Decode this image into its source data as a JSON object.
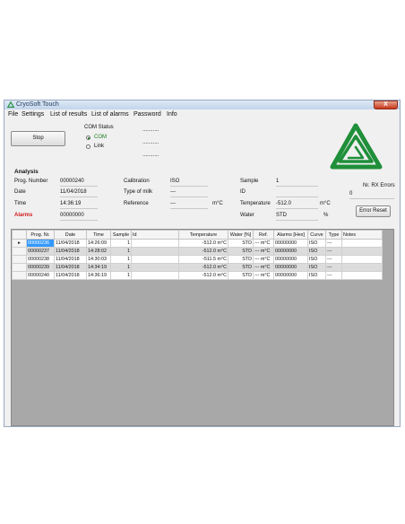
{
  "window": {
    "title": "CryoSoft Touch",
    "close_glyph": "X"
  },
  "menu": [
    "File",
    "Settings",
    "List of results",
    "List of alarms",
    "Password",
    "Info"
  ],
  "controls": {
    "stop_label": "Stop",
    "com_status_label": "COM Status",
    "com_option": "COM",
    "link_option": "Link",
    "status_lines": [
      "...........",
      "...........",
      "..........."
    ]
  },
  "analysis": {
    "heading": "Analysis",
    "prog_number_label": "Prog. Number",
    "prog_number": "00000240",
    "date_label": "Date",
    "date": "11/04/2018",
    "time_label": "Time",
    "time": "14:36:19",
    "alarms_label": "Alarms",
    "alarms": "00000000",
    "calibration_label": "Calibration",
    "calibration": "ISO",
    "milk_label": "Type of milk",
    "milk": "---",
    "reference_label": "Reference",
    "reference": "---",
    "reference_unit": "m°C",
    "sample_label": "Sample",
    "sample": "1",
    "id_label": "ID",
    "id": "",
    "temperature_label": "Temperature",
    "temperature": "-512.0",
    "temperature_unit": "m°C",
    "water_label": "Water",
    "water": "STD",
    "water_unit": "%"
  },
  "rx": {
    "label": "Nr. RX Errors",
    "value": "0",
    "reset_label": "Error Reset"
  },
  "logo": {
    "name": "triangle-logo",
    "color": "#1f8f3a"
  },
  "table": {
    "columns": [
      "Prog. Nr.",
      "Date",
      "Time",
      "Sample",
      "Id",
      "Temperature",
      "Water [%]",
      "Ref.",
      "Alarms [Hex]",
      "Curve",
      "Type",
      "Notes"
    ],
    "rows": [
      [
        "00000236",
        "11/04/2018",
        "14:26:09",
        "1",
        "",
        "-512.0 m°C",
        "STD",
        "--- m°C",
        "00000000",
        "ISO",
        "---",
        ""
      ],
      [
        "00000237",
        "11/04/2018",
        "14:28:02",
        "1",
        "",
        "-512.0 m°C",
        "STD",
        "--- m°C",
        "00000000",
        "ISO",
        "---",
        ""
      ],
      [
        "00000238",
        "11/04/2018",
        "14:30:03",
        "1",
        "",
        "-511.5 m°C",
        "STD",
        "--- m°C",
        "00000000",
        "ISO",
        "---",
        ""
      ],
      [
        "00000239",
        "11/04/2018",
        "14:34:19",
        "1",
        "",
        "-512.0 m°C",
        "STD",
        "--- m°C",
        "00000000",
        "ISO",
        "---",
        ""
      ],
      [
        "00000240",
        "11/04/2018",
        "14:36:19",
        "1",
        "",
        "-512.0 m°C",
        "STD",
        "--- m°C",
        "00000000",
        "ISO",
        "---",
        ""
      ]
    ],
    "selected_row": 0,
    "row_pointer": "▸"
  }
}
